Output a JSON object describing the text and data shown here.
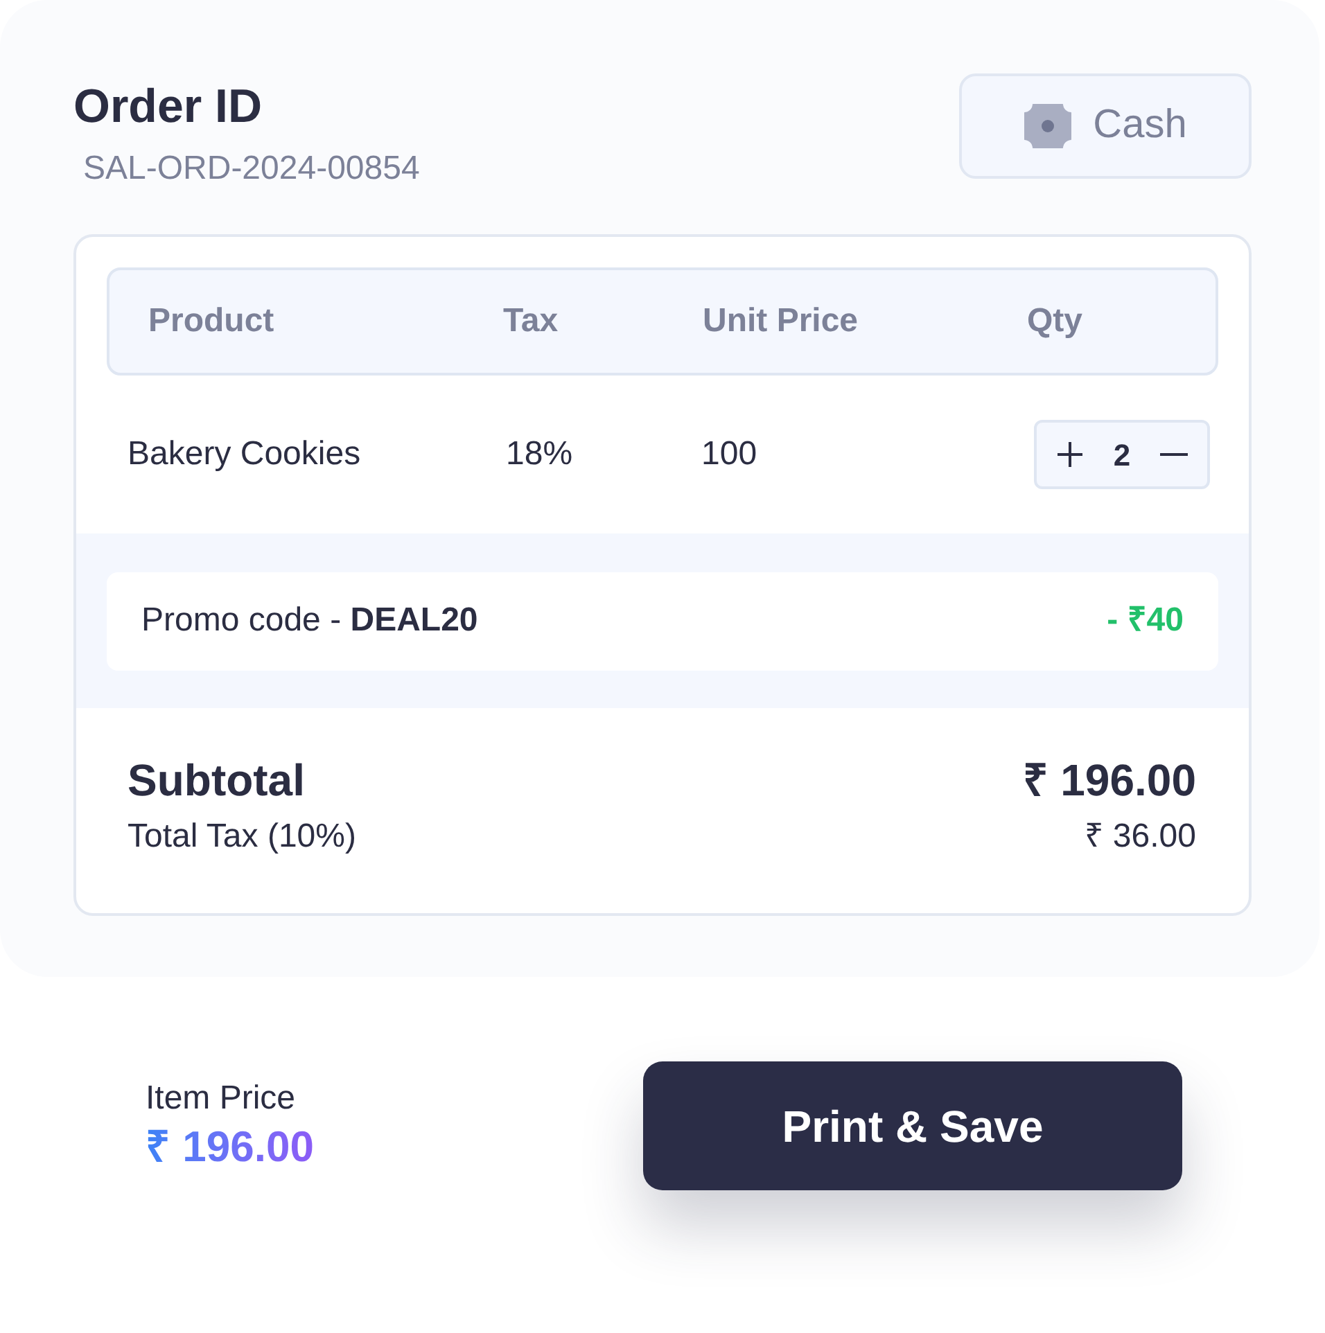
{
  "header": {
    "title": "Order ID",
    "order_id": "SAL-ORD-2024-00854",
    "payment_method": {
      "label": "Cash"
    }
  },
  "table": {
    "columns": [
      "Product",
      "Tax",
      "Unit Price",
      "Qty"
    ],
    "rows": [
      {
        "product": "Bakery Cookies",
        "tax": "18%",
        "unit_price": "100",
        "qty": "2"
      }
    ]
  },
  "promo": {
    "text": "Promo code - **DEAL20**",
    "discount": "- ₹40"
  },
  "summary": {
    "subtotal_label": "Subtotal",
    "subtotal_value": "₹ 196.00",
    "tax_label": "Total Tax (10%)",
    "tax_value": "₹ 36.00"
  },
  "footer": {
    "item_price_label": "Item Price",
    "item_price_value": "₹ 196.00",
    "primary_button": "Print & Save"
  }
}
